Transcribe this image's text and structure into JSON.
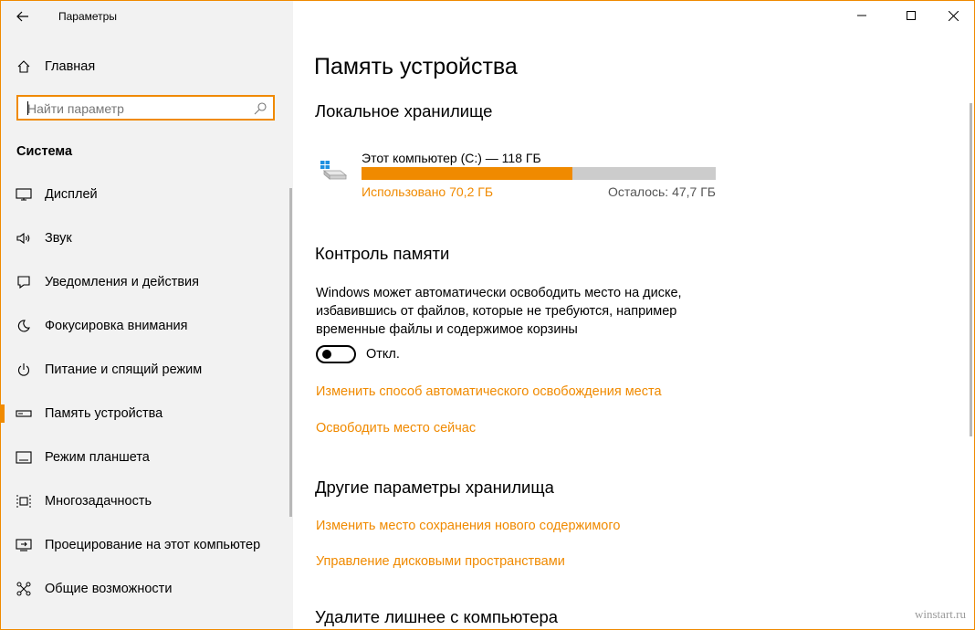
{
  "window": {
    "accent": "#f08a00"
  },
  "sidebar": {
    "app_title": "Параметры",
    "home_label": "Главная",
    "search_placeholder": "Найти параметр",
    "section": "Система",
    "items": [
      {
        "label": "Дисплей",
        "icon": "monitor-icon"
      },
      {
        "label": "Звук",
        "icon": "speaker-icon"
      },
      {
        "label": "Уведомления и действия",
        "icon": "notification-icon"
      },
      {
        "label": "Фокусировка внимания",
        "icon": "moon-icon"
      },
      {
        "label": "Питание и спящий режим",
        "icon": "power-icon"
      },
      {
        "label": "Память устройства",
        "icon": "storage-icon",
        "active": true
      },
      {
        "label": "Режим планшета",
        "icon": "tablet-icon"
      },
      {
        "label": "Многозадачность",
        "icon": "multitasking-icon"
      },
      {
        "label": "Проецирование на этот компьютер",
        "icon": "projecting-icon"
      },
      {
        "label": "Общие возможности",
        "icon": "shared-experiences-icon"
      }
    ]
  },
  "main": {
    "title": "Память устройства",
    "local_storage": {
      "heading": "Локальное хранилище",
      "drive_name": "Этот компьютер (C:) — 118 ГБ",
      "used": "Использовано 70,2 ГБ",
      "remaining": "Осталось: 47,7 ГБ",
      "used_fraction": 0.595
    },
    "storage_sense": {
      "heading": "Контроль памяти",
      "description": "Windows может автоматически освободить место на диске, избавившись от файлов, которые не требуются, например временные файлы и содержимое корзины",
      "toggle_state": "Откл.",
      "toggle_on": false,
      "link_change": "Изменить способ автоматического освобождения места",
      "link_free": "Освободить место сейчас"
    },
    "other": {
      "heading": "Другие параметры хранилища",
      "link_save_location": "Изменить место сохранения нового содержимого",
      "link_spaces": "Управление дисковыми пространствами"
    },
    "cleanup_heading": "Удалите лишнее с компьютера"
  },
  "watermark": "winstart.ru"
}
